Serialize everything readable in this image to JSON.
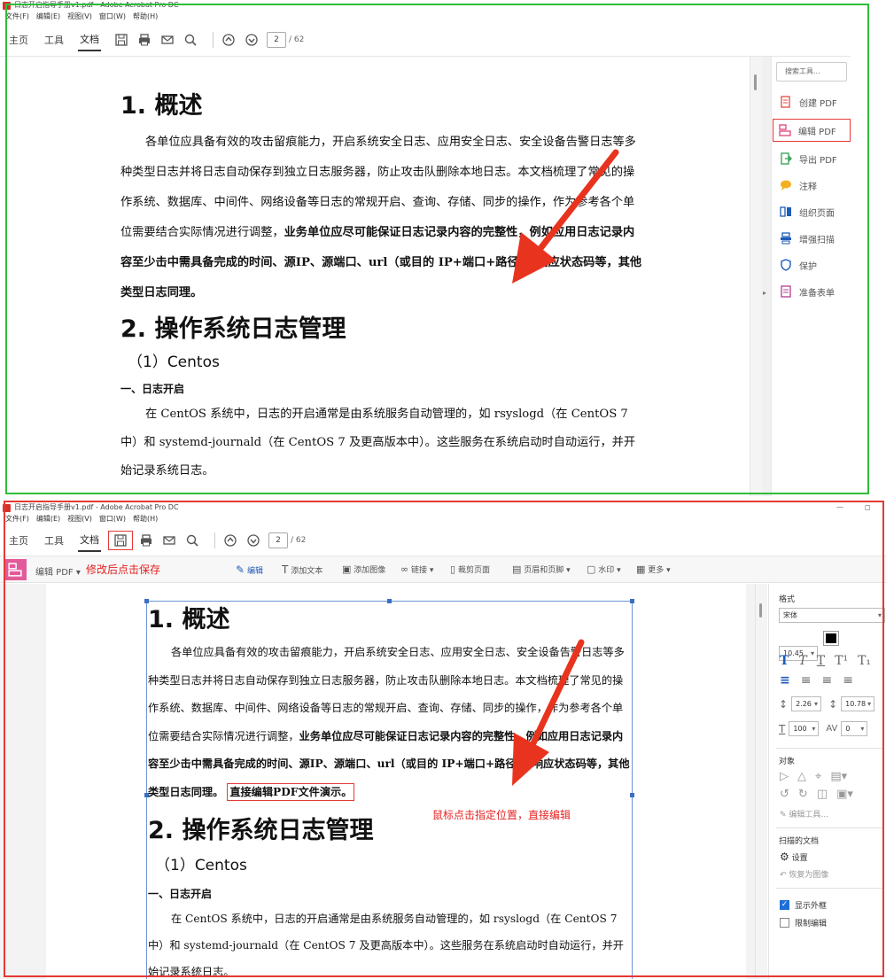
{
  "top_window": {
    "titlebar": "日志开启指导手册v1.pdf - Adobe Acrobat Pro DC",
    "menu": [
      "文件(F)",
      "编辑(E)",
      "视图(V)",
      "窗口(W)",
      "帮助(H)"
    ],
    "tabs": [
      "主页",
      "工具",
      "文档"
    ],
    "page_current": "2",
    "page_total": "/ 62",
    "search_tools_placeholder": "搜索工具...",
    "tools": [
      "创建 PDF",
      "编辑 PDF",
      "导出 PDF",
      "注释",
      "组织页面",
      "增强扫描",
      "保护",
      "准备表单"
    ]
  },
  "bottom_window": {
    "titlebar": "日志开启指导手册v1.pdf - Adobe Acrobat Pro DC",
    "menu": [
      "文件(F)",
      "编辑(E)",
      "视图(V)",
      "窗口(W)",
      "帮助(H)"
    ],
    "tabs": [
      "主页",
      "工具",
      "文档"
    ],
    "page_current": "2",
    "page_total": "/ 62",
    "edit_label": "编辑 PDF",
    "edit_toolbar": [
      "编辑",
      "添加文本",
      "添加图像",
      "链接",
      "裁剪页面",
      "页眉和页脚",
      "水印",
      "更多"
    ],
    "format": {
      "title": "格式",
      "font": "宋体",
      "font_size": "10.45",
      "line_spacing": "2.26",
      "para_spacing": "10.78",
      "scale": "100",
      "char_spacing": "0"
    },
    "objects": {
      "title": "对象",
      "edit_tool": "编辑工具..."
    },
    "scanned": {
      "title": "扫描的文档",
      "settings": "设置",
      "restore": "恢复为图像"
    },
    "checks": {
      "show_bbox": "显示外框",
      "restrict_edit": "限制编辑"
    }
  },
  "doc": {
    "h1": "1. 概述",
    "para_a": "各单位应具备有效的攻击留痕能力，开启系统安全日志、应用安全日志、安全设备告警日志等多种类型日志并将日志自动保存到独立日志服务器，防止攻击队删除本地日志。本文档梳理了常见的操作系统、数据库、中间件、网络设备等日志的常规开启、查询、存储、同步的操作，作为参考各个单位需要结合实际情况进行调整，",
    "para_b": "业务单位应尽可能保证日志记录内容的完整性，例如应用日志记录内容至少击中需具备完成的时间、源IP、源端口、url（或目的 IP+端口+路径）、响应状态码等，其他类型日志同理。",
    "inserted": "直接编辑PDF文件演示。",
    "h2": "2. 操作系统日志管理",
    "h3": "（1）Centos",
    "h4": "一、日志开启",
    "para_c": "在 CentOS 系统中，日志的开启通常是由系统服务自动管理的，如 rsyslogd（在 CentOS 7 中）和 systemd-journald（在 CentOS 7 及更高版本中）。这些服务在系统启动时自动运行，并开始记录系统日志。"
  },
  "annotations": {
    "save_hint": "修改后点击保存",
    "edit_hint": "鼠标点击指定位置，直接编辑"
  },
  "colors": {
    "green_frame": "#2ebd3a",
    "red_frame": "#e53935",
    "accent_blue": "#1e5bb8"
  }
}
